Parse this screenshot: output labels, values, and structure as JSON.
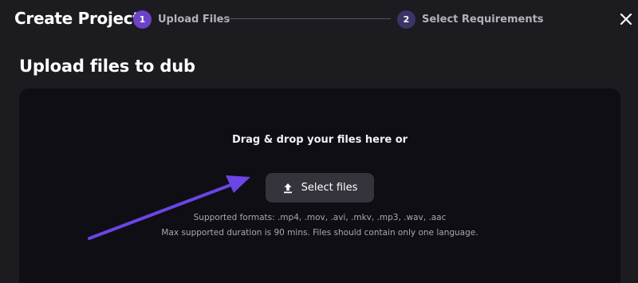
{
  "header": {
    "title": "Create Project",
    "close_icon": "close-icon"
  },
  "steps": [
    {
      "number": "1",
      "label": "Upload Files",
      "state": "active"
    },
    {
      "number": "2",
      "label": "Select Requirements",
      "state": "inactive"
    }
  ],
  "main": {
    "section_title": "Upload files to dub",
    "dropzone": {
      "prompt": "Drag & drop your files here or",
      "select_button_label": "Select files",
      "select_button_icon": "upload-icon",
      "supported_formats": "Supported formats: .mp4, .mov, .avi, .mkv, .mp3, .wav, .aac",
      "duration_note": "Max supported duration is 90 mins. Files should contain only one language."
    }
  },
  "colors": {
    "background": "#1c1b20",
    "dropzone": "#0f0e14",
    "accent": "#6a43c9",
    "annotation_arrow": "#6b45e6"
  }
}
